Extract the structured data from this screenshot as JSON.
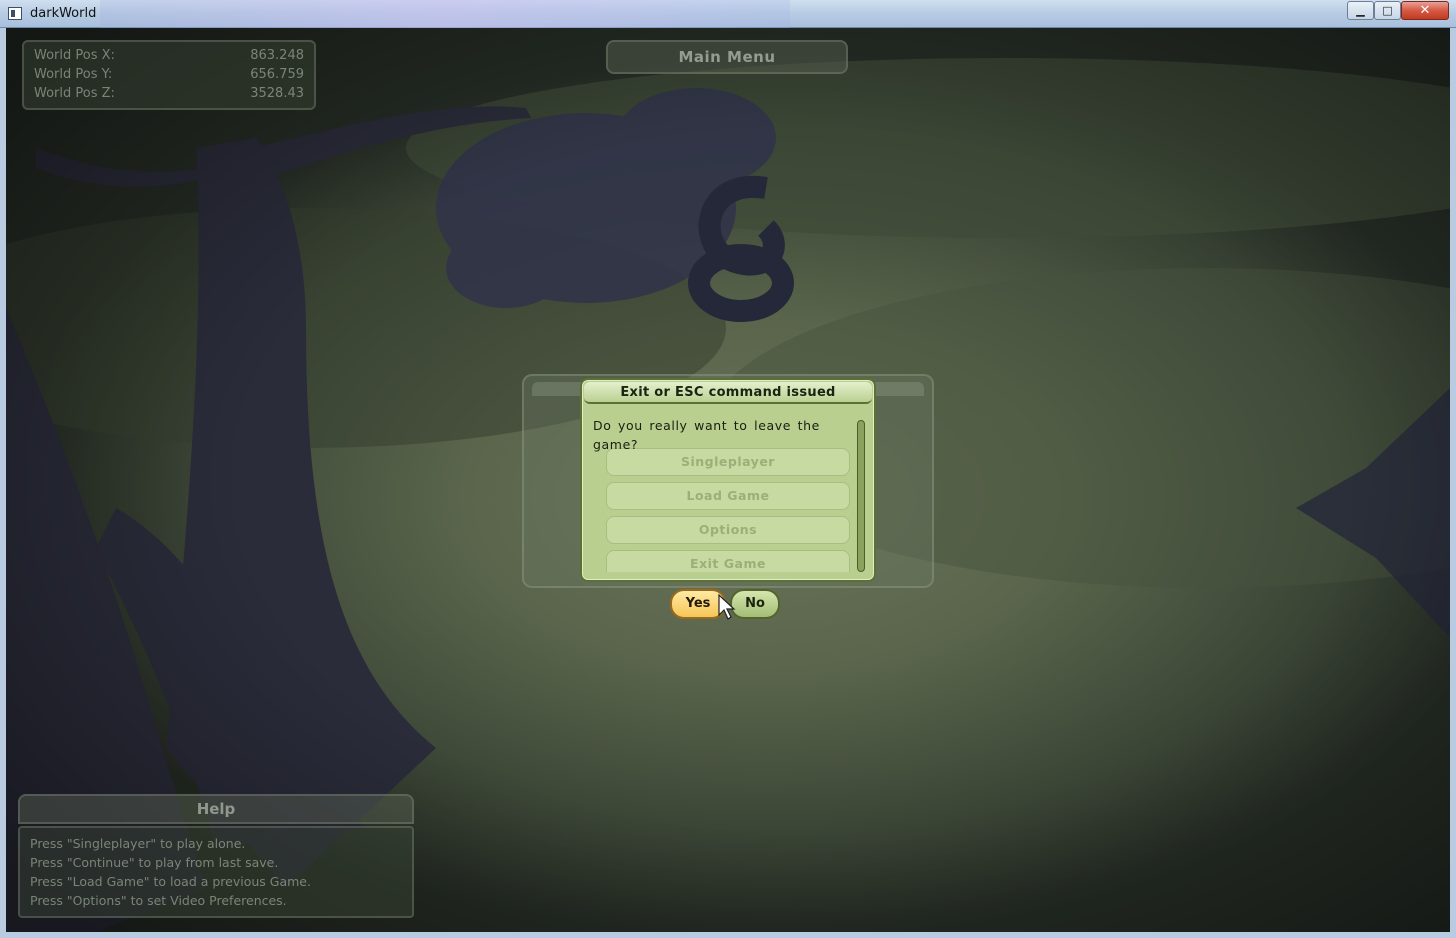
{
  "window": {
    "title": "darkWorld",
    "minimize_glyph": "▁",
    "maximize_glyph": "□",
    "close_glyph": "✕"
  },
  "world_pos": {
    "rows": [
      {
        "label": "World Pos X:",
        "value": "863.248"
      },
      {
        "label": "World Pos Y:",
        "value": "656.759"
      },
      {
        "label": "World Pos Z:",
        "value": "3528.43"
      }
    ]
  },
  "main_menu": {
    "title": "Main Menu",
    "items": [
      "Singleplayer",
      "Load Game",
      "Options",
      "Exit Game"
    ]
  },
  "dialog": {
    "title": "Exit or ESC command issued",
    "message": "Do you really want to leave the game?",
    "yes_label": "Yes",
    "no_label": "No"
  },
  "help": {
    "title": "Help",
    "lines": [
      "Press \"Singleplayer\" to play alone.",
      "Press \"Continue\" to play from last save.",
      "Press \"Load Game\" to load a previous Game.",
      "Press \"Options\" to set Video Preferences."
    ]
  },
  "colors": {
    "dialog_bg": "#b8cf90",
    "yes_button": "#f6c657",
    "no_button": "#a4bd76",
    "close_button": "#c23a22"
  },
  "icons": [
    "app-icon",
    "cursor-icon",
    "tree-icon",
    "snake-icon"
  ]
}
